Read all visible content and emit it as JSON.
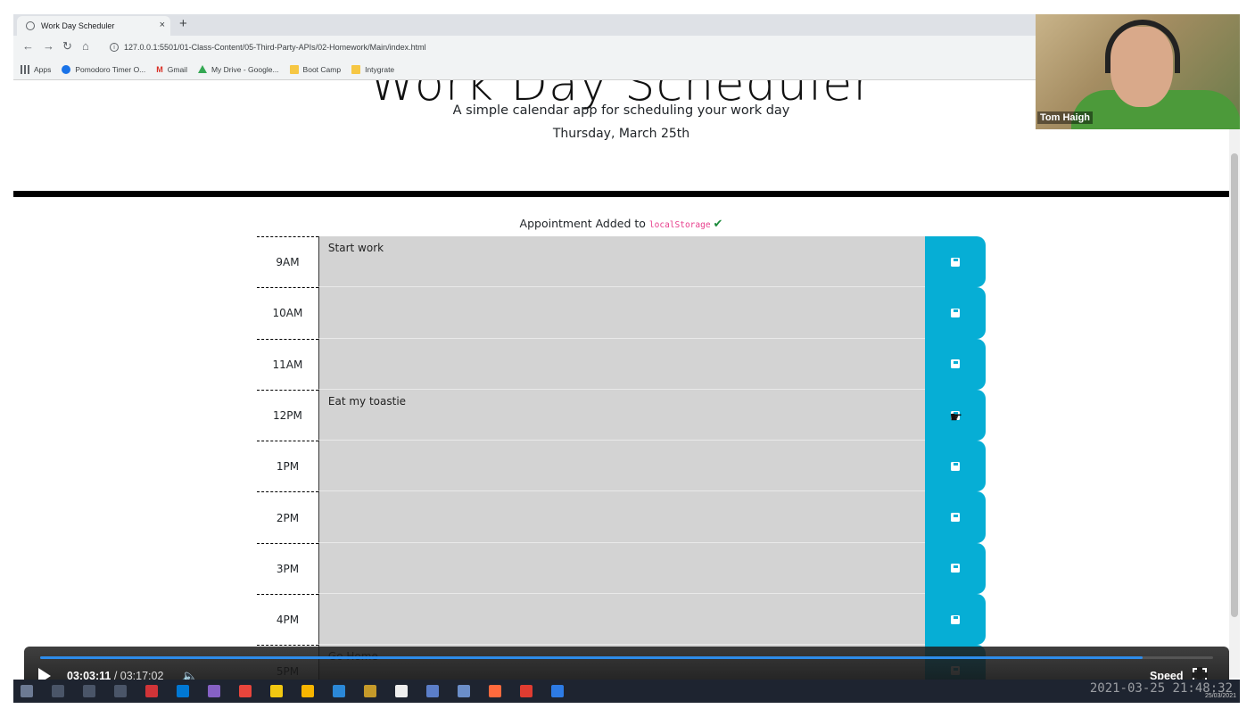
{
  "browser": {
    "tab_title": "Work Day Scheduler",
    "new_tab": "+",
    "tab_close": "×",
    "url": "127.0.0.1:5501/01-Class-Content/05-Third-Party-APIs/02-Homework/Main/index.html",
    "bookmarks": [
      {
        "label": "Apps",
        "icon": "apps-icon"
      },
      {
        "label": "Pomodoro Timer O...",
        "icon": "pomodoro-icon"
      },
      {
        "label": "Gmail",
        "icon": "gmail-icon"
      },
      {
        "label": "My Drive - Google...",
        "icon": "drive-icon"
      },
      {
        "label": "Boot Camp",
        "icon": "folder-icon"
      },
      {
        "label": "Intygrate",
        "icon": "folder-icon"
      }
    ]
  },
  "header": {
    "title": "Work Day Scheduler",
    "lead": "A simple calendar app for scheduling your work day",
    "current_day": "Thursday, March 25th"
  },
  "notice": {
    "text": "Appointment Added to ",
    "code": "localStorage",
    "check": "✔"
  },
  "timeblocks": [
    {
      "hour": "9AM",
      "text": "Start work"
    },
    {
      "hour": "10AM",
      "text": ""
    },
    {
      "hour": "11AM",
      "text": ""
    },
    {
      "hour": "12PM",
      "text": "Eat my toastie"
    },
    {
      "hour": "1PM",
      "text": ""
    },
    {
      "hour": "2PM",
      "text": ""
    },
    {
      "hour": "3PM",
      "text": ""
    },
    {
      "hour": "4PM",
      "text": ""
    },
    {
      "hour": "5PM",
      "text": "Go Home"
    }
  ],
  "colors": {
    "save_button": "#06aed5",
    "textarea_bg": "#d3d3d3",
    "progress": "#2d8ceb"
  },
  "webcam": {
    "name": "Tom Haigh"
  },
  "player": {
    "current_time": "03:03:11",
    "separator": " / ",
    "total_time": "03:17:02",
    "progress_fraction": 0.94,
    "speed_label": "Speed"
  },
  "taskbar": {
    "clock": "2021-03-25 21:48:32",
    "date": "25/03/2021"
  }
}
